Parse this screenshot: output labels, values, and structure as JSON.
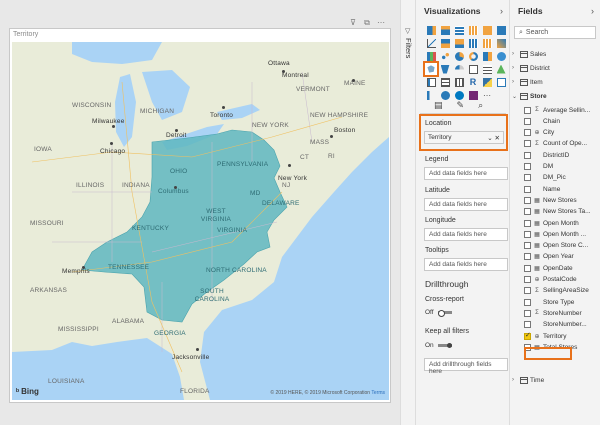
{
  "map": {
    "title": "Territory",
    "bing": "Bing",
    "copyright": "© 2019 HERE, © 2019 Microsoft Corporation",
    "terms": "Terms",
    "shade_color": "#5fb7c0",
    "labels": {
      "wisconsin": "WISCONSIN",
      "michigan": "MICHIGAN",
      "iowa": "IOWA",
      "illinois": "ILLINOIS",
      "indiana": "INDIANA",
      "ohio": "OHIO",
      "pennsylvania": "PENNSYLVANIA",
      "new_york": "NEW YORK",
      "vermont": "VERMONT",
      "new_hampshire": "NEW HAMPSHIRE",
      "maine": "MAINE",
      "mass": "MASS",
      "ct": "CT",
      "ri": "RI",
      "nj": "NJ",
      "md": "MD",
      "delaware": "DELAWARE",
      "west_virginia": "WEST VIRGINIA",
      "virginia": "VIRGINIA",
      "kentucky": "KENTUCKY",
      "missouri": "MISSOURI",
      "tennessee": "TENNESSEE",
      "north_carolina": "NORTH CAROLINA",
      "south_carolina": "SOUTH CAROLINA",
      "arkansas": "ARKANSAS",
      "mississippi": "MISSISSIPPI",
      "alabama": "ALABAMA",
      "georgia": "GEORGIA",
      "louisiana": "LOUISIANA",
      "florida": "FLORIDA",
      "montreal": "Montreal",
      "ottawa": "Ottawa",
      "toronto": "Toronto",
      "milwaukee": "Milwaukee",
      "chicago": "Chicago",
      "detroit": "Detroit",
      "boston": "Boston",
      "new_york_city": "New York",
      "columbus": "Columbus",
      "memphis": "Memphis",
      "jacksonville": "Jacksonville"
    }
  },
  "filters": {
    "label": "Filters"
  },
  "visualizations": {
    "title": "Visualizations",
    "location_label": "Location",
    "location_value": "Territory",
    "legend_label": "Legend",
    "legend_placeholder": "Add data fields here",
    "latitude_label": "Latitude",
    "latitude_placeholder": "Add data fields here",
    "longitude_label": "Longitude",
    "longitude_placeholder": "Add data fields here",
    "tooltips_label": "Tooltips",
    "tooltips_placeholder": "Add data fields here",
    "drillthrough_title": "Drillthrough",
    "cross_report_label": "Cross-report",
    "cross_report_value": "Off",
    "keep_filters_label": "Keep all filters",
    "keep_filters_value": "On",
    "drillthrough_placeholder": "Add drillthrough fields here"
  },
  "fields": {
    "title": "Fields",
    "search_placeholder": "Search",
    "tables": {
      "sales": "Sales",
      "district": "District",
      "item": "Item",
      "store": "Store",
      "time": "Time"
    },
    "store_fields": [
      {
        "name": "Average Sellin...",
        "type": "Σ",
        "checked": false
      },
      {
        "name": "Chain",
        "type": "",
        "checked": false
      },
      {
        "name": "City",
        "type": "⊕",
        "checked": false
      },
      {
        "name": "Count of Ope...",
        "type": "Σ",
        "checked": false
      },
      {
        "name": "DistrictID",
        "type": "",
        "checked": false
      },
      {
        "name": "DM",
        "type": "",
        "checked": false
      },
      {
        "name": "DM_Pic",
        "type": "",
        "checked": false
      },
      {
        "name": "Name",
        "type": "",
        "checked": false
      },
      {
        "name": "New Stores",
        "type": "▦",
        "checked": false
      },
      {
        "name": "New Stores Ta...",
        "type": "▦",
        "checked": false
      },
      {
        "name": "Open Month",
        "type": "▦",
        "checked": false
      },
      {
        "name": "Open Month ...",
        "type": "▦",
        "checked": false
      },
      {
        "name": "Open Store C...",
        "type": "▦",
        "checked": false
      },
      {
        "name": "Open Year",
        "type": "▦",
        "checked": false
      },
      {
        "name": "OpenDate",
        "type": "▦",
        "checked": false
      },
      {
        "name": "PostalCode",
        "type": "⊕",
        "checked": false
      },
      {
        "name": "SellingAreaSize",
        "type": "Σ",
        "checked": false
      },
      {
        "name": "Store Type",
        "type": "",
        "checked": false
      },
      {
        "name": "StoreNumber",
        "type": "Σ",
        "checked": false
      },
      {
        "name": "StoreNumber...",
        "type": "",
        "checked": false
      },
      {
        "name": "Territory",
        "type": "⊕",
        "checked": true
      },
      {
        "name": "Total Stores",
        "type": "▦",
        "checked": false
      }
    ]
  }
}
